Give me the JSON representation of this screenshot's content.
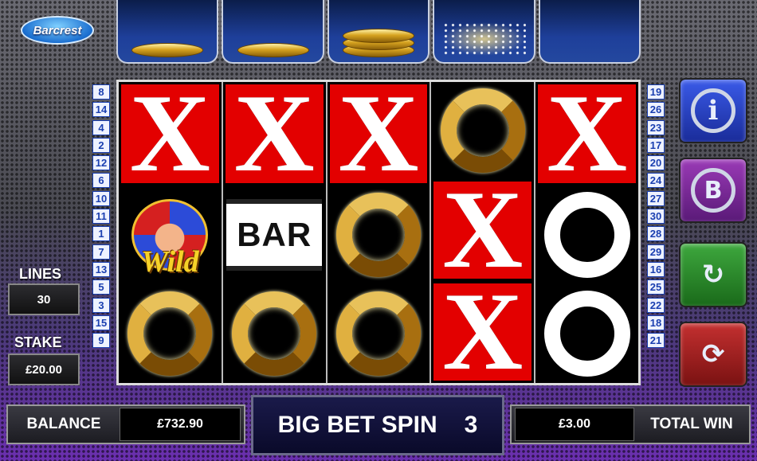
{
  "brand": {
    "logo_text": "Barcrest"
  },
  "tray": {
    "slots": [
      {
        "coins": 1
      },
      {
        "coins": 1
      },
      {
        "coins": 3
      },
      {
        "coins": 0,
        "sparkle": true
      },
      {
        "coins": 0
      }
    ]
  },
  "lines_left": [
    "8",
    "14",
    "4",
    "2",
    "12",
    "6",
    "10",
    "11",
    "1",
    "7",
    "13",
    "5",
    "3",
    "15",
    "9"
  ],
  "lines_right": [
    "19",
    "26",
    "23",
    "17",
    "20",
    "24",
    "27",
    "30",
    "28",
    "29",
    "16",
    "25",
    "22",
    "18",
    "21"
  ],
  "reels": [
    [
      {
        "symbol": "X",
        "bg": "red"
      },
      {
        "symbol": "WILD",
        "bg": "black"
      },
      {
        "symbol": "GOLD_O",
        "bg": "black"
      }
    ],
    [
      {
        "symbol": "X",
        "bg": "red"
      },
      {
        "symbol": "BAR",
        "bg": "black"
      },
      {
        "symbol": "GOLD_O",
        "bg": "black"
      }
    ],
    [
      {
        "symbol": "X",
        "bg": "red"
      },
      {
        "symbol": "GOLD_O",
        "bg": "black"
      },
      {
        "symbol": "GOLD_O",
        "bg": "black"
      }
    ],
    [
      {
        "symbol": "GOLD_O",
        "bg": "black"
      },
      {
        "symbol": "X",
        "bg": "red"
      },
      {
        "symbol": "X",
        "bg": "red"
      }
    ],
    [
      {
        "symbol": "X",
        "bg": "red"
      },
      {
        "symbol": "WHITE_O",
        "bg": "black"
      },
      {
        "symbol": "WHITE_O",
        "bg": "black"
      }
    ]
  ],
  "symbols": {
    "x_text": "X",
    "bar_text": "BAR",
    "wild_text": "Wild"
  },
  "side_buttons": {
    "info_glyph": "i",
    "bb_glyph": "B",
    "gamble_glyph": "↻",
    "autoplay_glyph": "⟳"
  },
  "lines": {
    "label": "LINES",
    "value": "30"
  },
  "stake": {
    "label": "STAKE",
    "value": "£20.00"
  },
  "balance": {
    "label": "BALANCE",
    "value": "£732.90"
  },
  "big_bet": {
    "label": "BIG BET SPIN",
    "count": "3"
  },
  "total_win": {
    "label": "TOTAL WIN",
    "value": "£3.00"
  },
  "colors": {
    "reel_red": "#e30000",
    "gold": "#d8a42a",
    "background_purple": "#6b2fb0"
  }
}
